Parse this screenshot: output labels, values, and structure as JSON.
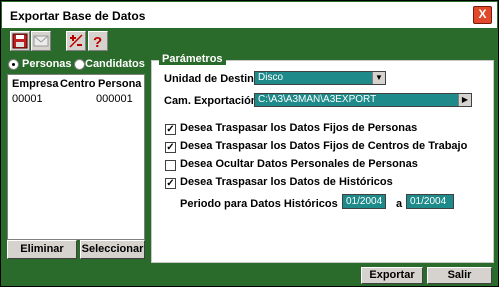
{
  "window": {
    "title": "Exportar Base de Datos",
    "close_glyph": "X"
  },
  "toolbar": {
    "icons": [
      "save-icon",
      "mail-icon",
      "plus-minus-icon",
      "help-icon"
    ]
  },
  "left": {
    "radio_personas": "Personas",
    "radio_candidatos": "Candidatos",
    "selected": "Personas",
    "columns": [
      "Empresa",
      "Centro",
      "Persona"
    ],
    "rows": [
      {
        "empresa": "00001",
        "centro": "",
        "persona": "000001"
      }
    ],
    "btn_eliminar": "Eliminar",
    "btn_seleccionar": "Seleccionar"
  },
  "params": {
    "legend": "Parámetros",
    "unidad_label": "Unidad de Destino",
    "unidad_value": "Disco",
    "cam_label": "Cam. Exportación:",
    "cam_value": "C:\\A3\\A3MAN\\A3EXPORT",
    "checks": [
      {
        "label": "Desea Traspasar los Datos Fijos de Personas",
        "checked": true
      },
      {
        "label": "Desea Traspasar los Datos Fijos de Centros de Trabajo",
        "checked": true
      },
      {
        "label": "Desea Ocultar Datos Personales de Personas",
        "checked": false
      },
      {
        "label": "Desea Traspasar los Datos de Históricos",
        "checked": true
      }
    ],
    "periodo_label": "Periodo para Datos Históricos",
    "periodo_from": "01/2004",
    "periodo_sep": "a",
    "periodo_to": "01/2004"
  },
  "footer": {
    "exportar": "Exportar",
    "salir": "Salir"
  },
  "colors": {
    "panel_green": "#2a6a2a",
    "field_teal": "#1f8a8a",
    "close_red": "#e04a2a"
  }
}
